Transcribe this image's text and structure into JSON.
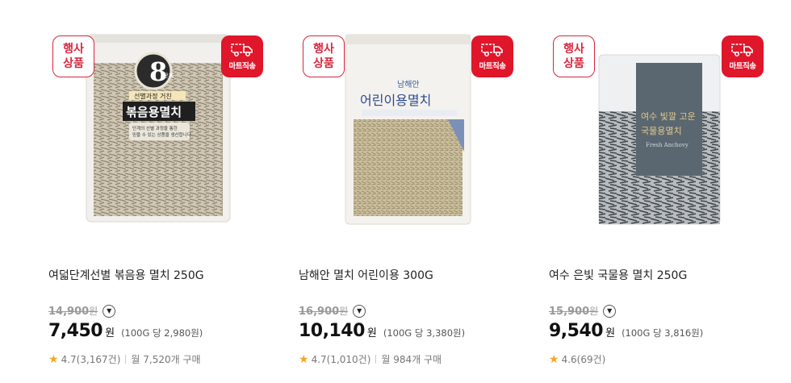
{
  "products": [
    {
      "event_badge": [
        "행사",
        "상품"
      ],
      "ship_badge": "마트직송",
      "name": "여덟단계선별 볶음용 멸치 250G",
      "original_price": "14,900",
      "won": "원",
      "sale_price": "7,450",
      "unit_price": "(100G 당 2,980원)",
      "rating": "4.7(3,167건)",
      "monthly": "월 7,520개 구매",
      "package": {
        "big": "8",
        "small": "단계",
        "sub": "선별과정 거친",
        "title": "볶음용멸치",
        "desc1": "단계의 선별 과정을 통한",
        "desc2": "믿을 수 있는 상품을 생산합니다."
      }
    },
    {
      "event_badge": [
        "행사",
        "상품"
      ],
      "ship_badge": "마트직송",
      "name": "남해안 멸치 어린이용 300G",
      "original_price": "16,900",
      "won": "원",
      "sale_price": "10,140",
      "unit_price": "(100G 당 3,380원)",
      "rating": "4.7(1,010건)",
      "monthly": "월 984개 구매",
      "package": {
        "sub": "남해안",
        "title": "어린이용멸치"
      }
    },
    {
      "event_badge": [
        "행사",
        "상품"
      ],
      "ship_badge": "마트직송",
      "name": "여수 은빛 국물용 멸치 250G",
      "original_price": "15,900",
      "won": "원",
      "sale_price": "9,540",
      "unit_price": "(100G 당 3,816원)",
      "rating": "4.6(69건)",
      "monthly": "",
      "package": {
        "title1": "여수 빛깔 고운",
        "title2": "국물용멸치",
        "brand": "Fresh Anchovy"
      }
    }
  ],
  "icons": {
    "truck": "truck-icon",
    "star": "star-icon",
    "info": "chevron-down-circle-icon"
  },
  "colors": {
    "accent_red": "#e0162b",
    "star": "#f5a623"
  }
}
